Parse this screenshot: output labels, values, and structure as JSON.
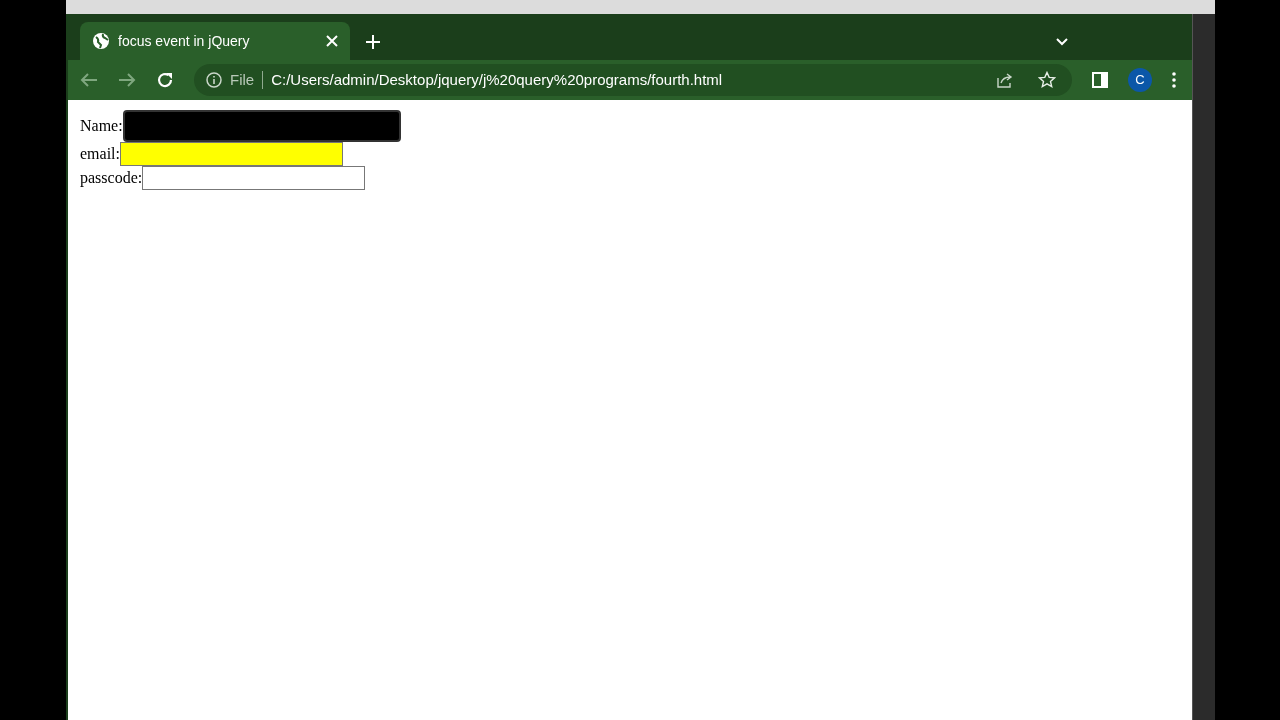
{
  "browser": {
    "tab": {
      "title": "focus event in jQuery",
      "selected": true
    },
    "address_bar": {
      "scheme_label": "File",
      "url": "C:/Users/admin/Desktop/jquery/j%20query%20programs/fourth.html"
    },
    "profile": {
      "initial": "C"
    }
  },
  "form": {
    "fields": [
      {
        "label": "Name:",
        "color": "#000000",
        "focused": true
      },
      {
        "label": "email:",
        "color": "#ffff00",
        "focused": false
      },
      {
        "label": "passcode:",
        "color": "#ffffff",
        "focused": false
      }
    ]
  }
}
